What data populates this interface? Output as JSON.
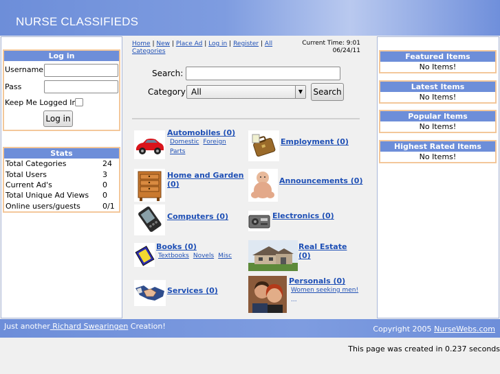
{
  "site": {
    "title": "NURSE CLASSIFIEDS"
  },
  "login": {
    "heading": "Log in",
    "username_label": "Username",
    "pass_label": "Pass",
    "keep_label": "Keep Me Logged In",
    "button": "Log in"
  },
  "stats": {
    "heading": "Stats",
    "rows": [
      {
        "label": "Total Categories",
        "value": "24"
      },
      {
        "label": "Total Users",
        "value": "3"
      },
      {
        "label": "Current Ad's",
        "value": "0"
      },
      {
        "label": "Total Unique Ad Views",
        "value": "0"
      },
      {
        "label": "Online users/guests",
        "value": "0/1"
      }
    ]
  },
  "nav": {
    "home": "Home",
    "new": "New",
    "place_ad": "Place Ad",
    "login": "Log in",
    "register": "Register",
    "all_categories_1": "All",
    "all_categories_2": "Categories",
    "sep": "|"
  },
  "time": {
    "line1": "Current Time: 9:01",
    "line2": "06/24/11"
  },
  "search": {
    "search_label": "Search:",
    "category_label": "Category",
    "category_value": "All",
    "button": "Search"
  },
  "categories": [
    {
      "title": "Automobiles (0)",
      "subs": [
        "Domestic",
        "Foreign",
        "Parts"
      ]
    },
    {
      "title": "Employment (0)",
      "subs": []
    },
    {
      "title_1": "Home and Garden",
      "title_2": "(0)",
      "subs": []
    },
    {
      "title": "Announcements (0)",
      "subs": []
    },
    {
      "title": "Computers (0)",
      "subs": []
    },
    {
      "title": "Electronics (0)",
      "subs": []
    },
    {
      "title": "Books (0)",
      "subs": [
        "Textbooks",
        "Novels",
        "Misc"
      ]
    },
    {
      "title_1": "Real Estate",
      "title_2": "(0)",
      "subs": []
    },
    {
      "title": "Services (0)",
      "subs": []
    },
    {
      "title": "Personals (0)",
      "subs": [
        "Women seeking men!"
      ],
      "more": "..."
    }
  ],
  "sidebar": {
    "featured": {
      "heading": "Featured Items",
      "text": "No Items!"
    },
    "latest": {
      "heading": "Latest Items",
      "text": "No Items!"
    },
    "popular": {
      "heading": "Popular Items",
      "text": "No Items!"
    },
    "rated": {
      "heading": "Highest Rated Items",
      "text": "No Items!"
    }
  },
  "footer": {
    "left_prefix": "Just another",
    "left_link": " Richard Swearingen",
    "left_suffix": " Creation!",
    "right_prefix": "Copyright 2005 ",
    "right_link": "NurseWebs.com",
    "created": "This page was created in 0.237 seconds"
  },
  "colors": {
    "header_blue": "#6d8ed9",
    "box_border": "#f3c79a",
    "link": "#1e4fb5"
  }
}
